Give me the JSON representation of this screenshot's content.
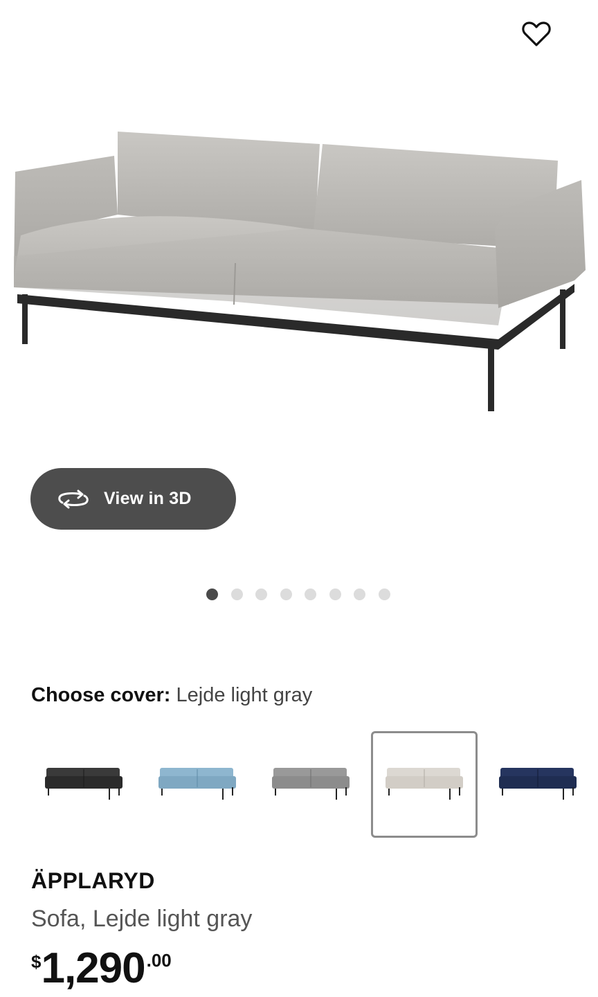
{
  "product_image": {
    "alt_icon": "sofa-image"
  },
  "favorite": {
    "icon": "heart-icon"
  },
  "view3d": {
    "label": "View in 3D",
    "icon": "rotate-3d-icon"
  },
  "carousel": {
    "count": 8,
    "active_index": 0
  },
  "cover": {
    "label": "Choose cover:",
    "value": "Lejde light gray",
    "options": [
      {
        "color": "#2b2b2b",
        "selected": false
      },
      {
        "color": "#7fa8c2",
        "selected": false
      },
      {
        "color": "#8c8c8c",
        "selected": false
      },
      {
        "color": "#d2cdc6",
        "selected": true
      },
      {
        "color": "#1f2d52",
        "selected": false
      }
    ]
  },
  "product": {
    "name": "ÄPPLARYD",
    "description": "Sofa, Lejde light gray",
    "price_currency": "$",
    "price_integer": "1,290",
    "price_decimal": ".00"
  }
}
